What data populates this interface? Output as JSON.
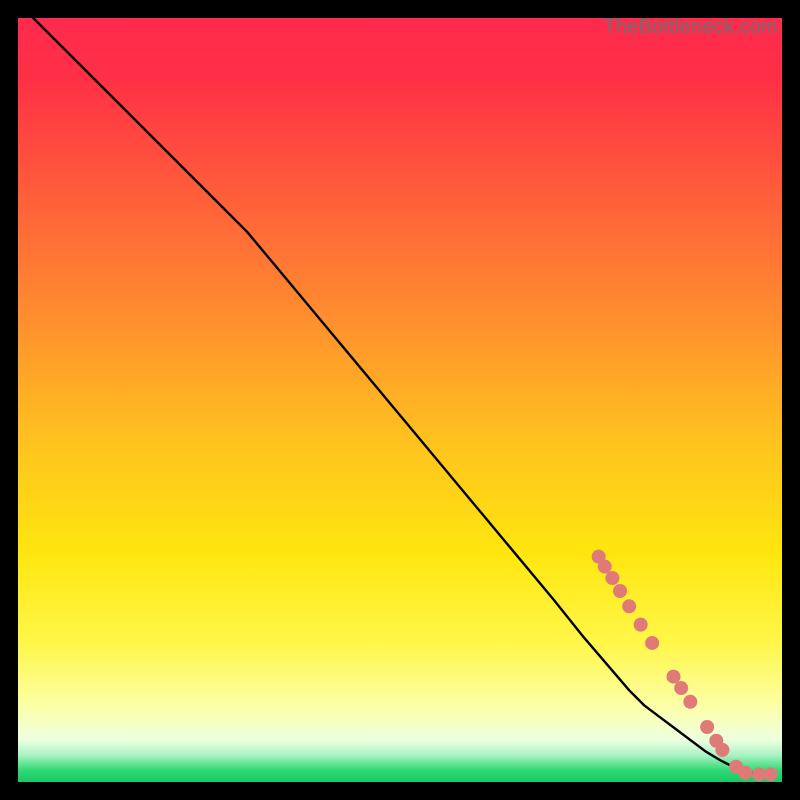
{
  "watermark": "TheBottleneck.com",
  "chart_data": {
    "type": "line",
    "title": "",
    "xlabel": "",
    "ylabel": "",
    "xlim": [
      0,
      100
    ],
    "ylim": [
      0,
      100
    ],
    "background_gradient": {
      "stops": [
        {
          "offset": 0.0,
          "color": "#ff2a4d"
        },
        {
          "offset": 0.08,
          "color": "#ff3046"
        },
        {
          "offset": 0.22,
          "color": "#ff5a3b"
        },
        {
          "offset": 0.38,
          "color": "#ff8a30"
        },
        {
          "offset": 0.55,
          "color": "#ffc11f"
        },
        {
          "offset": 0.7,
          "color": "#ffe60f"
        },
        {
          "offset": 0.82,
          "color": "#fff74a"
        },
        {
          "offset": 0.9,
          "color": "#fdffa6"
        },
        {
          "offset": 0.945,
          "color": "#eeffe0"
        },
        {
          "offset": 0.965,
          "color": "#a9f2c3"
        },
        {
          "offset": 0.985,
          "color": "#2fd974"
        },
        {
          "offset": 1.0,
          "color": "#18c964"
        }
      ]
    },
    "series": [
      {
        "name": "curve",
        "x": [
          2,
          10,
          18,
          26,
          30,
          35,
          40,
          45,
          50,
          55,
          60,
          65,
          70,
          74,
          77,
          80,
          82,
          84,
          86,
          88,
          90,
          92,
          94,
          96,
          98
        ],
        "y": [
          100,
          92,
          84,
          76,
          72,
          66,
          60,
          54,
          48,
          42,
          36,
          30,
          24,
          19,
          15.5,
          12,
          10,
          8.5,
          7,
          5.5,
          4,
          2.8,
          1.8,
          1.2,
          1.0
        ]
      }
    ],
    "markers": {
      "name": "highlight-points",
      "color": "#e07a78",
      "radius": 7,
      "points": [
        {
          "x": 76.0,
          "y": 29.5
        },
        {
          "x": 76.8,
          "y": 28.2
        },
        {
          "x": 77.8,
          "y": 26.7
        },
        {
          "x": 78.8,
          "y": 25.0
        },
        {
          "x": 80.0,
          "y": 23.0
        },
        {
          "x": 81.5,
          "y": 20.6
        },
        {
          "x": 83.0,
          "y": 18.2
        },
        {
          "x": 85.8,
          "y": 13.8
        },
        {
          "x": 86.8,
          "y": 12.3
        },
        {
          "x": 88.0,
          "y": 10.5
        },
        {
          "x": 90.2,
          "y": 7.2
        },
        {
          "x": 91.4,
          "y": 5.4
        },
        {
          "x": 92.2,
          "y": 4.2
        },
        {
          "x": 94.0,
          "y": 2.0
        },
        {
          "x": 95.2,
          "y": 1.2
        },
        {
          "x": 97.0,
          "y": 1.0
        },
        {
          "x": 98.5,
          "y": 1.0
        }
      ]
    }
  }
}
